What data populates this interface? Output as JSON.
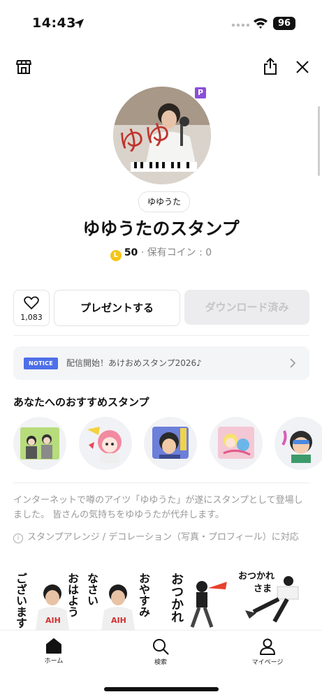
{
  "status_bar": {
    "time": "14:43",
    "battery": "96"
  },
  "header": {
    "icons": [
      "shop-icon",
      "share-icon",
      "close-icon"
    ]
  },
  "avatar": {
    "badge": "P",
    "handwriting": "ゆゆ"
  },
  "author": "ゆゆうた",
  "title": "ゆゆうたのスタンプ",
  "price": {
    "coin_letter": "L",
    "amount": "50",
    "separator": "·",
    "owned_label": "保有コイン : 0"
  },
  "actions": {
    "like_count": "1,083",
    "present_label": "プレゼントする",
    "download_label": "ダウンロード済み"
  },
  "notice": {
    "badge": "NOTICE",
    "text": "配信開始！あけおめスタンプ2026♪"
  },
  "recommended": {
    "title": "あなたへのおすすめスタンプ",
    "count": 5
  },
  "description": "インターネットで噂のアイツ「ゆゆうた」が遂にスタンプとして登場しました。 皆さんの気持ちをゆゆうたが代弁します。",
  "info": {
    "icon": "i",
    "text": "スタンプアレンジ / デコレーション（写真・プロフィール）に対応"
  },
  "stickers": [
    {
      "lines": [
        "おはよう",
        "ございます"
      ]
    },
    {
      "lines": [
        "おやすみ",
        "なさい"
      ]
    },
    {
      "lines": [
        "おつかれ"
      ]
    },
    {
      "lines": [
        "おつかれ",
        "さま"
      ]
    }
  ],
  "bottom_nav": [
    {
      "label": "ホーム",
      "icon": "home-icon"
    },
    {
      "label": "検索",
      "icon": "search-icon"
    },
    {
      "label": "マイページ",
      "icon": "person-icon"
    }
  ],
  "colors": {
    "accent_blue": "#4d6fe8",
    "coin": "#f5c518",
    "premium_purple": "#8a4fd8"
  }
}
